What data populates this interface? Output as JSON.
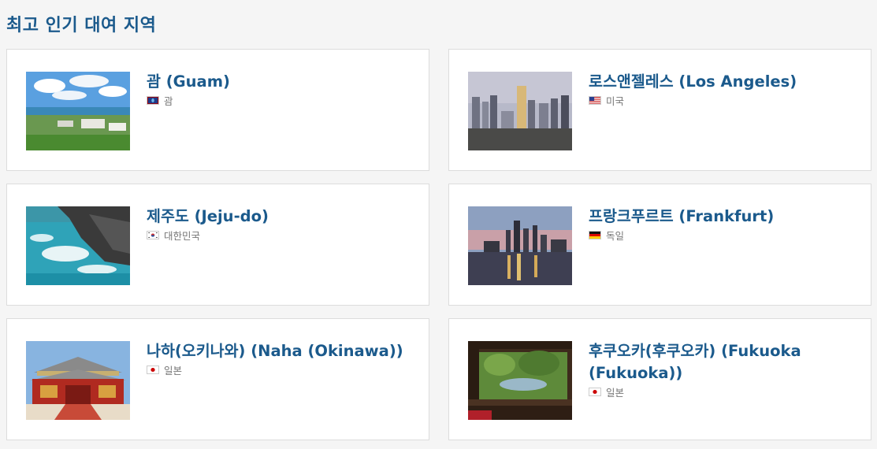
{
  "section": {
    "title": "최고 인기 대여 지역"
  },
  "destinations": [
    {
      "city": "괌 (Guam)",
      "country": "괌",
      "flag_icon": "guam-flag-icon",
      "photo": "guam-coastline-photo"
    },
    {
      "city": "로스앤젤레스 (Los Angeles)",
      "country": "미국",
      "flag_icon": "usa-flag-icon",
      "photo": "los-angeles-skyline-photo"
    },
    {
      "city": "제주도 (Jeju-do)",
      "country": "대한민국",
      "flag_icon": "south-korea-flag-icon",
      "photo": "jeju-rocky-coast-photo"
    },
    {
      "city": "프랑크푸르트 (Frankfurt)",
      "country": "독일",
      "flag_icon": "germany-flag-icon",
      "photo": "frankfurt-skyline-dusk-photo"
    },
    {
      "city": "나하(오키나와) (Naha (Okinawa))",
      "country": "일본",
      "flag_icon": "japan-flag-icon",
      "photo": "shuri-castle-photo"
    },
    {
      "city": "후쿠오카(후쿠오카) (Fukuoka (Fukuoka))",
      "country": "일본",
      "flag_icon": "japan-flag-icon",
      "photo": "japanese-garden-photo"
    }
  ],
  "colors": {
    "title": "#1b5a8c",
    "background": "#f5f5f5",
    "card": "#ffffff",
    "border": "#dcdcdc",
    "muted_text": "#777777"
  }
}
